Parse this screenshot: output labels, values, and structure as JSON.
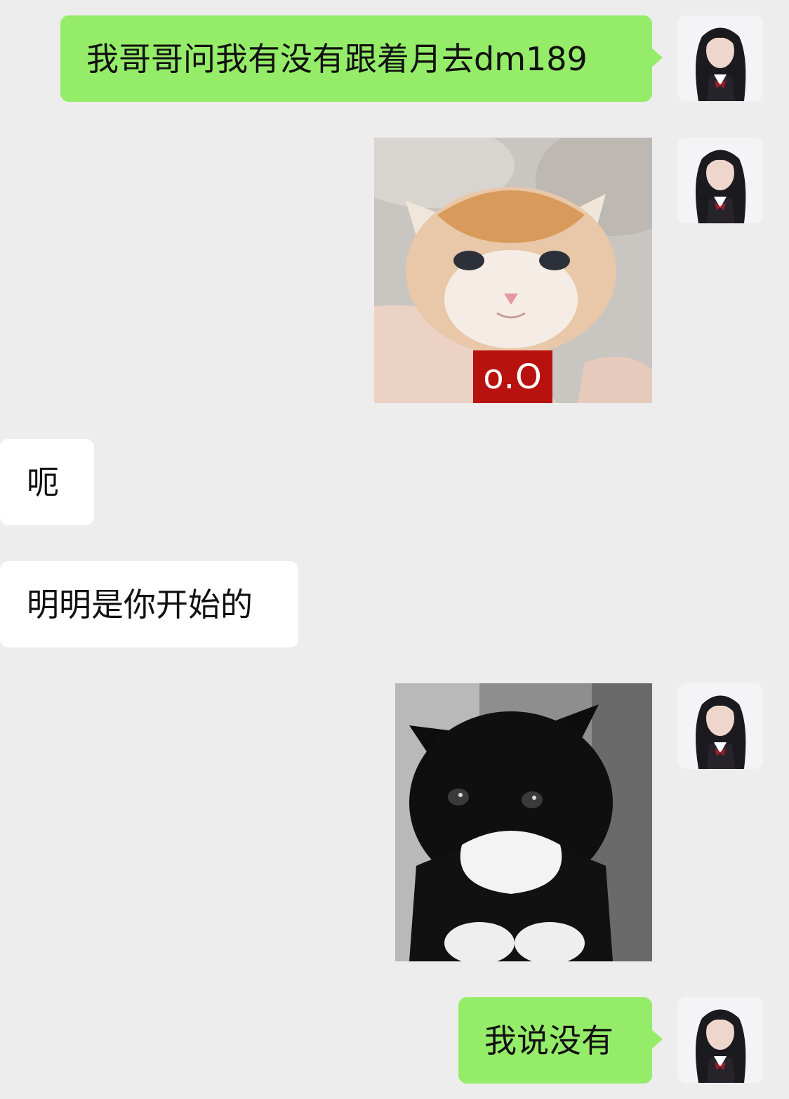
{
  "conversation": {
    "messages": [
      {
        "sender": "me",
        "type": "text",
        "text": "我哥哥问我有没有跟着月去dm189"
      },
      {
        "sender": "me",
        "type": "sticker",
        "sticker": "orange-kitten",
        "caption": "o.O"
      },
      {
        "sender": "other",
        "type": "text",
        "text": "呃"
      },
      {
        "sender": "other",
        "type": "text",
        "text": "明明是你开始的"
      },
      {
        "sender": "me",
        "type": "sticker",
        "sticker": "black-white-kitten"
      },
      {
        "sender": "me",
        "type": "text",
        "text": "我说没有"
      }
    ]
  },
  "colors": {
    "background": "#ededed",
    "outgoing_bubble": "#95ec69",
    "incoming_bubble": "#ffffff",
    "caption_red": "#b8120f"
  },
  "icons": [
    "user-avatar",
    "orange-kitten-sticker",
    "black-white-kitten-sticker"
  ]
}
